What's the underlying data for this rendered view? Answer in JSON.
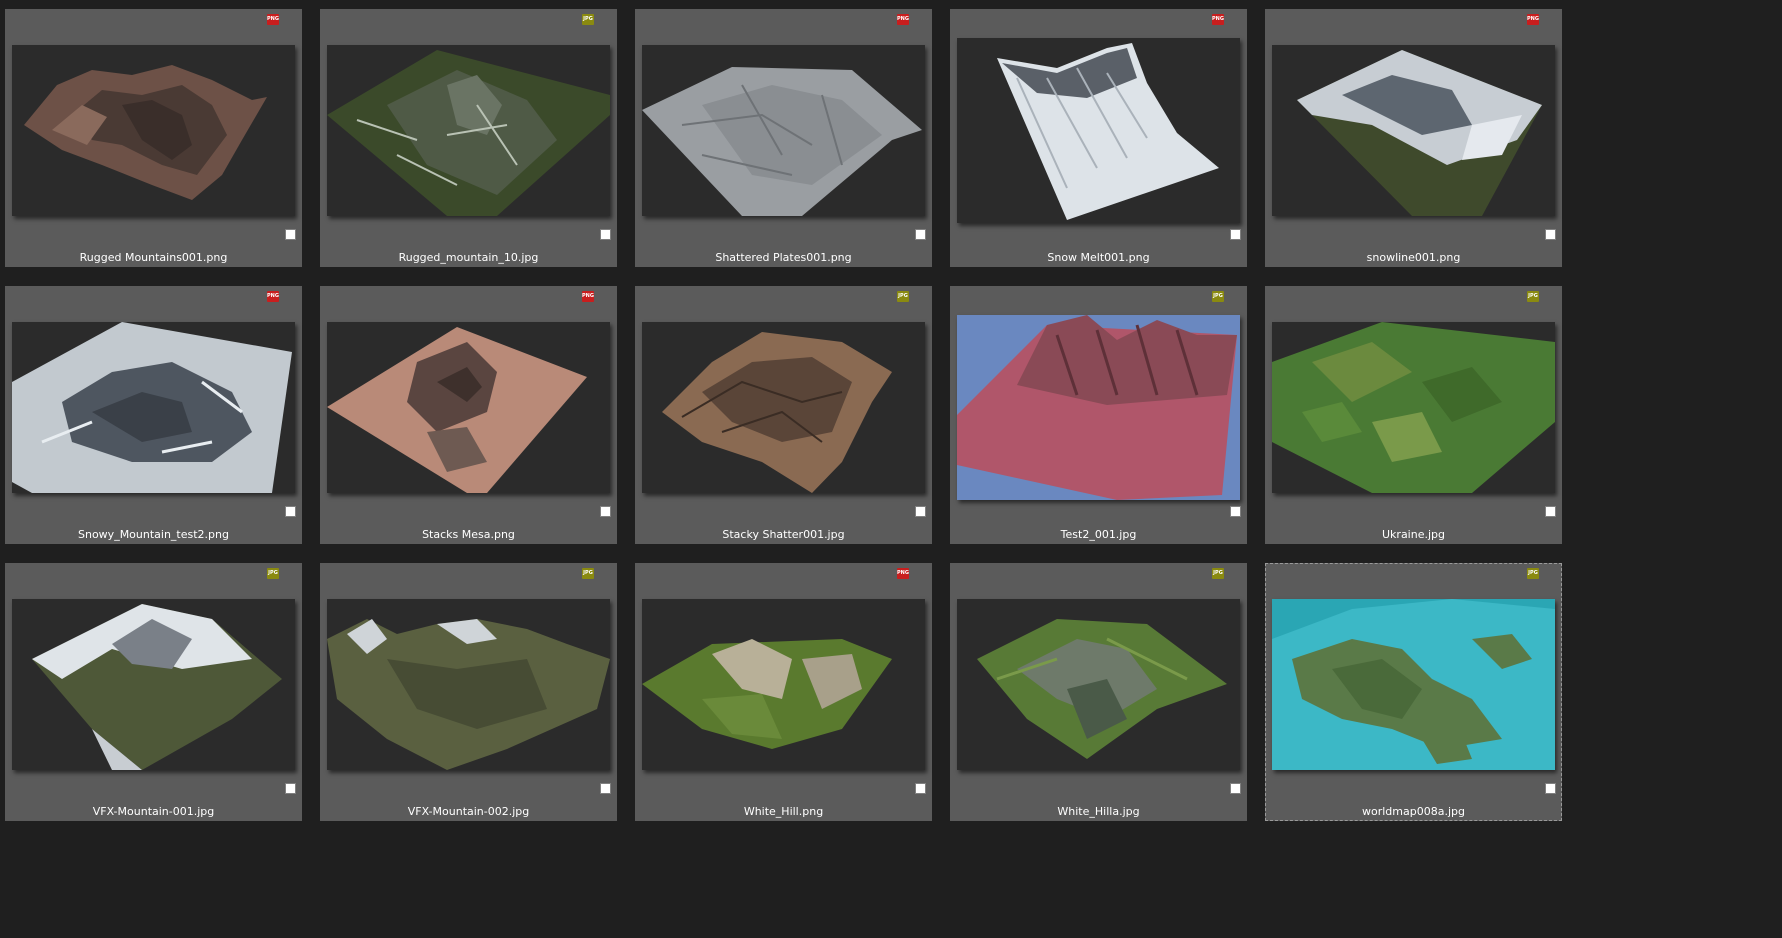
{
  "badges": {
    "png": {
      "label": "PNG",
      "color": "#c81e1e"
    },
    "jpg": {
      "label": "JPG",
      "color": "#8a8a10"
    }
  },
  "files": [
    {
      "name": "Rugged Mountains001.png",
      "type": "png",
      "selected": false,
      "icon": "terrain-thumbnail-brown-rock"
    },
    {
      "name": "Rugged_mountain_10.jpg",
      "type": "jpg",
      "selected": false,
      "icon": "terrain-thumbnail-green-mountain"
    },
    {
      "name": "Shattered Plates001.png",
      "type": "png",
      "selected": false,
      "icon": "terrain-thumbnail-grey-plates"
    },
    {
      "name": "Snow Melt001.png",
      "type": "png",
      "selected": false,
      "icon": "terrain-thumbnail-snow-slope"
    },
    {
      "name": "snowline001.png",
      "type": "png",
      "selected": false,
      "icon": "terrain-thumbnail-snowline"
    },
    {
      "name": "Snowy_Mountain_test2.png",
      "type": "png",
      "selected": false,
      "icon": "terrain-thumbnail-snowy-mountain"
    },
    {
      "name": "Stacks Mesa.png",
      "type": "png",
      "selected": false,
      "icon": "terrain-thumbnail-mesa"
    },
    {
      "name": "Stacky Shatter001.jpg",
      "type": "jpg",
      "selected": false,
      "icon": "terrain-thumbnail-shatter"
    },
    {
      "name": "Test2_001.jpg",
      "type": "jpg",
      "selected": false,
      "icon": "terrain-thumbnail-red-ridges"
    },
    {
      "name": "Ukraine.jpg",
      "type": "jpg",
      "selected": false,
      "icon": "terrain-thumbnail-farmland"
    },
    {
      "name": "VFX-Mountain-001.jpg",
      "type": "jpg",
      "selected": false,
      "icon": "terrain-thumbnail-alpine-peak"
    },
    {
      "name": "VFX-Mountain-002.jpg",
      "type": "jpg",
      "selected": false,
      "icon": "terrain-thumbnail-alpine-range"
    },
    {
      "name": "White_Hill.png",
      "type": "png",
      "selected": false,
      "icon": "terrain-thumbnail-green-hills"
    },
    {
      "name": "White_Hilla.jpg",
      "type": "jpg",
      "selected": false,
      "icon": "terrain-thumbnail-green-valley"
    },
    {
      "name": "worldmap008a.jpg",
      "type": "jpg",
      "selected": true,
      "icon": "terrain-thumbnail-island-map"
    }
  ]
}
